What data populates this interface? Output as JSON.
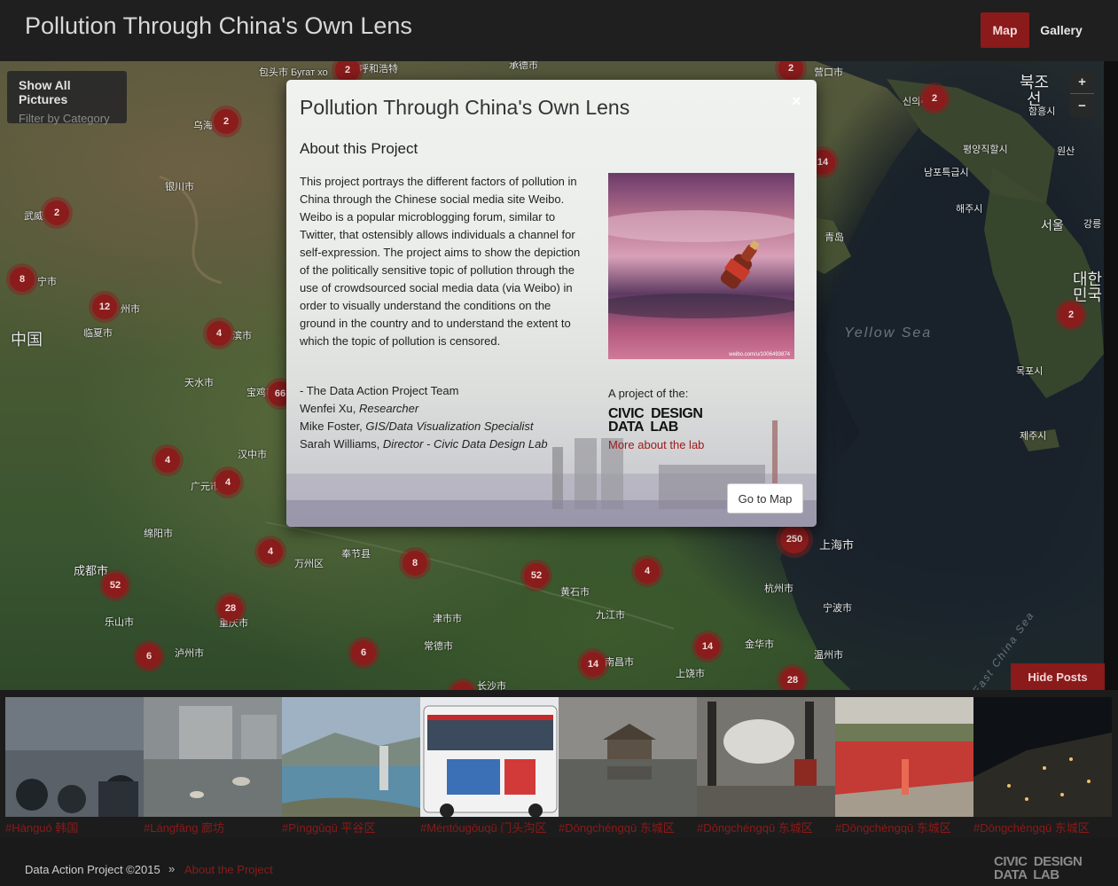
{
  "header": {
    "title": "Pollution Through China's Own Lens",
    "nav": {
      "map": "Map",
      "gallery": "Gallery"
    }
  },
  "map": {
    "filter": {
      "show_all": "Show All Pictures",
      "filter_by": "Filter by Category"
    },
    "zoom": {
      "in": "+",
      "out": "−"
    },
    "labels": [
      "包头市 Бугат хо",
      "呼和浩特",
      "承德市",
      "营口市",
      "乌海",
      "银川市",
      "武威",
      "宁市",
      "州市",
      "中国",
      "临夏市",
      "滨市",
      "天水市",
      "宝鸡市",
      "汉中市",
      "广元市",
      "绵阳市",
      "成都市",
      "奉节县",
      "万州区",
      "乐山市",
      "泸州市",
      "重庆市",
      "常德市",
      "津市市",
      "长沙市",
      "黄石市",
      "九江市",
      "南昌市",
      "上饶市",
      "金华市",
      "温州市",
      "宁波市",
      "杭州市",
      "上海市",
      "青岛",
      "신의주",
      "북조선",
      "함흥시",
      "평양직할시",
      "원산",
      "남포특급시",
      "해주시",
      "서울",
      "강릉",
      "대한민국",
      "목포시",
      "제주시"
    ],
    "sea_labels": [
      "Yellow Sea",
      "East China Sea"
    ],
    "clusters": [
      "2",
      "2",
      "2",
      "2",
      "2",
      "2",
      "8",
      "12",
      "4",
      "4",
      "4",
      "4",
      "66",
      "8",
      "52",
      "52",
      "4",
      "28",
      "6",
      "6",
      "14",
      "14",
      "14",
      "2",
      "250",
      "28"
    ],
    "hide_posts": "Hide Posts"
  },
  "modal": {
    "title": "Pollution Through China's Own Lens",
    "close": "×",
    "subtitle": "About this Project",
    "body": "This project portrays the different factors of pollution in China through the Chinese social media site Weibo. Weibo is a popular microblogging forum, similar to Twitter, that ostensibly allows individuals a channel for self-expression. The project aims to show the depiction of the politically sensitive topic of pollution through the use of crowdsourced social media data (via Weibo) in order to visually understand the conditions on the ground in the country and to understand the extent to which the topic of pollution is censored.",
    "team_intro": "- The Data Action Project Team",
    "team": [
      {
        "name": "Wenfei Xu,",
        "role": "Researcher"
      },
      {
        "name": "Mike Foster,",
        "role": "GIS/Data Visualization Specialist"
      },
      {
        "name": "Sarah Williams,",
        "role": "Director - Civic Data Design Lab"
      }
    ],
    "photo_watermark": "weibo.com/u/1006493874",
    "project_of": "A project of the:",
    "lab_logo": {
      "line1": "CIVIC  DESIGN",
      "line2": "DATA  LAB"
    },
    "lab_link": "More about the lab",
    "go_to_map": "Go to Map"
  },
  "gallery_strip": [
    {
      "caption": "#Hánguó 韩国"
    },
    {
      "caption": "#Lángfāng 廊坊"
    },
    {
      "caption": "#Pínggǔqū 平谷区"
    },
    {
      "caption": "#Méntóugōuqū 门头沟区"
    },
    {
      "caption": "#Dōngchéngqū 东城区"
    },
    {
      "caption": "#Dōngchéngqū 东城区"
    },
    {
      "caption": "#Dōngchéngqū 东城区"
    },
    {
      "caption": "#Dōngchéngqū 东城区"
    }
  ],
  "footer": {
    "copyright": "Data Action Project ©2015",
    "separator": "»",
    "about": "About the Project",
    "logo": {
      "line1": "CIVIC  DESIGN",
      "line2": "DATA  LAB"
    }
  },
  "colors": {
    "accent": "#8b1a1a",
    "topbar": "#1f1f1f",
    "link_red": "#a11a1a"
  }
}
